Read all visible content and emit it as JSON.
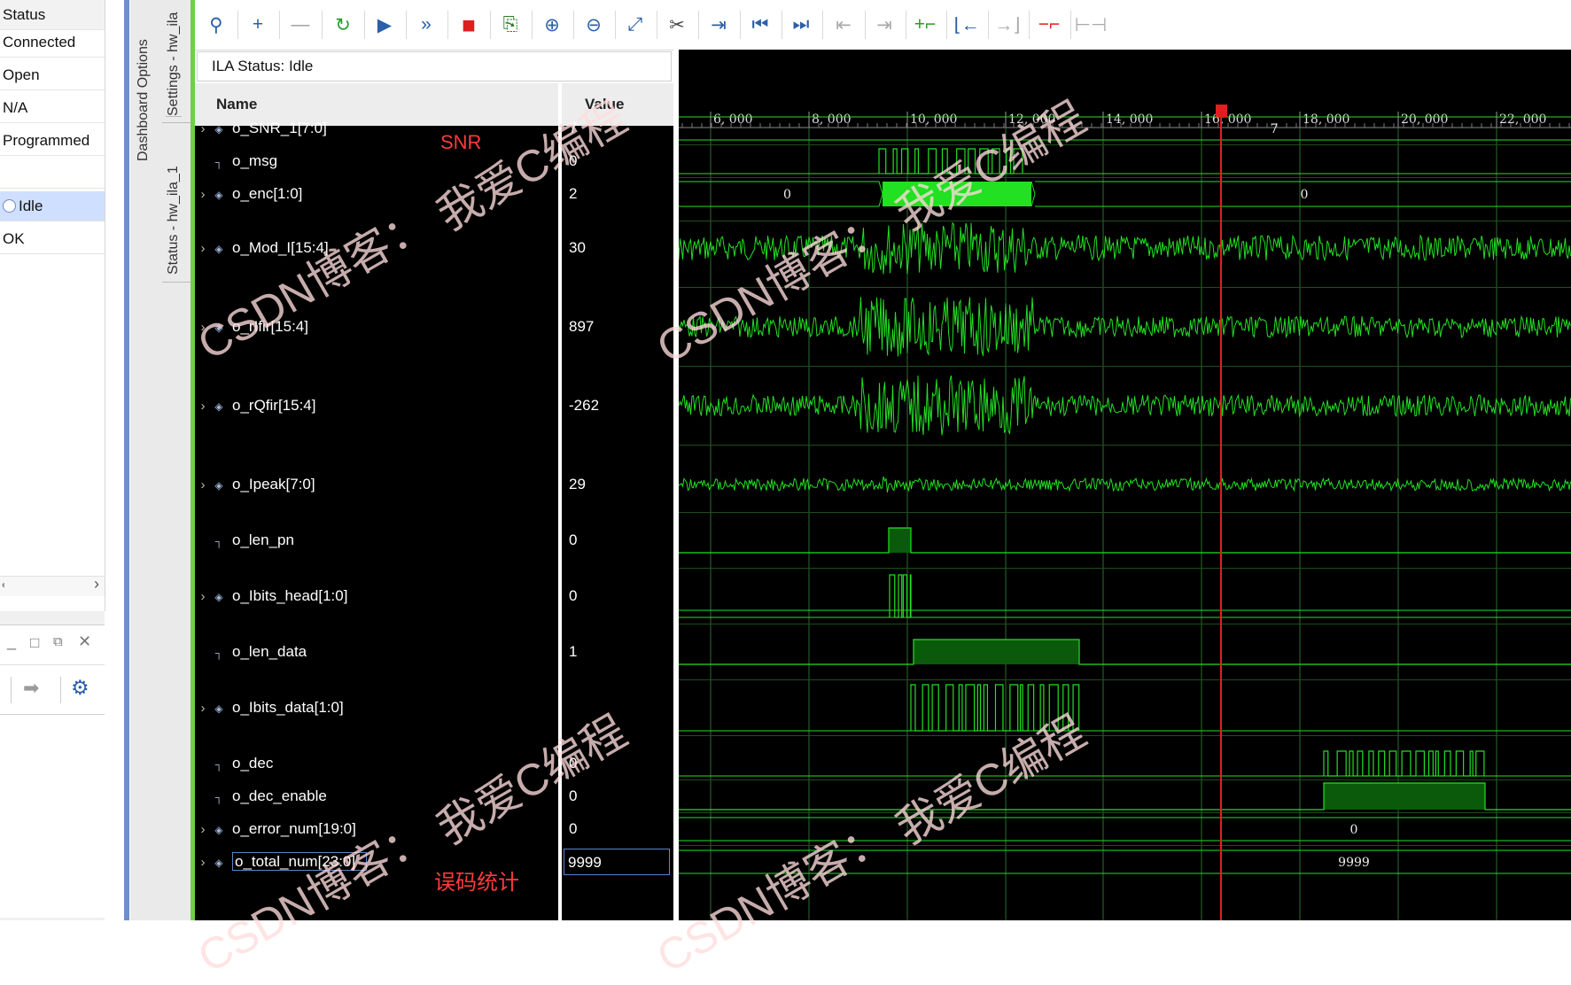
{
  "left_panel": {
    "header": "Status",
    "rows": [
      {
        "text": "Connected",
        "selected": false,
        "radio": false
      },
      {
        "text": "Open",
        "selected": false,
        "radio": false
      },
      {
        "text": "N/A",
        "selected": false,
        "radio": false
      },
      {
        "text": "Programmed",
        "selected": false,
        "radio": false
      },
      {
        "text": "",
        "selected": false,
        "radio": false
      },
      {
        "text": "Idle",
        "selected": true,
        "radio": true
      },
      {
        "text": "OK",
        "selected": false,
        "radio": false
      }
    ]
  },
  "vertical_tabs": {
    "dashboard": "Dashboard Options",
    "settings": "Settings - hw_ila",
    "status": "Status - hw_ila_1"
  },
  "toolbar": {
    "icons": [
      "search-icon",
      "add-icon",
      "remove-icon",
      "refresh-icon",
      "run-icon",
      "run-fast-icon",
      "stop-icon",
      "export-icon",
      "zoom-in-icon",
      "zoom-out-icon",
      "zoom-fit-icon",
      "marker-cut-icon",
      "marker-add-icon",
      "go-first-icon",
      "go-last-icon",
      "prev-edge-icon",
      "next-edge-icon",
      "add-marker-icon",
      "prev-marker-icon",
      "next-marker-icon",
      "delete-marker-icon",
      "measure-icon"
    ]
  },
  "ila_status": "ILA Status:  Idle",
  "columns": {
    "name": "Name",
    "value": "Value"
  },
  "signals": [
    {
      "name": "o_SNR_1[7:0]",
      "value": "7",
      "expandable": true,
      "bus": true
    },
    {
      "name": "o_msg",
      "value": "0",
      "expandable": false,
      "bus": false
    },
    {
      "name": "o_enc[1:0]",
      "value": "2",
      "expandable": true,
      "bus": true
    },
    {
      "name": "o_Mod_I[15:4]",
      "value": "30",
      "expandable": true,
      "bus": true
    },
    {
      "name": "o_rIfir[15:4]",
      "value": "897",
      "expandable": true,
      "bus": true
    },
    {
      "name": "o_rQfir[15:4]",
      "value": "-262",
      "expandable": true,
      "bus": true
    },
    {
      "name": "o_Ipeak[7:0]",
      "value": "29",
      "expandable": true,
      "bus": true
    },
    {
      "name": "o_len_pn",
      "value": "0",
      "expandable": false,
      "bus": false
    },
    {
      "name": "o_Ibits_head[1:0]",
      "value": "0",
      "expandable": true,
      "bus": true
    },
    {
      "name": "o_len_data",
      "value": "1",
      "expandable": false,
      "bus": false
    },
    {
      "name": "o_Ibits_data[1:0]",
      "value": "",
      "expandable": true,
      "bus": true
    },
    {
      "name": "o_dec",
      "value": "0",
      "expandable": false,
      "bus": false
    },
    {
      "name": "o_dec_enable",
      "value": "0",
      "expandable": false,
      "bus": false
    },
    {
      "name": "o_error_num[19:0]",
      "value": "0",
      "expandable": true,
      "bus": true
    },
    {
      "name": "o_total_num[23:0]",
      "value": "9999",
      "expandable": true,
      "bus": true
    }
  ],
  "time_ruler": {
    "labels": [
      "6, 000",
      "8, 000",
      "10, 000",
      "12, 000",
      "14, 000",
      "16, 000",
      "18, 000",
      "20, 000",
      "22, 000"
    ]
  },
  "bus_labels": {
    "snr": "7",
    "enc_left": "0",
    "enc_right": "0",
    "error": "0",
    "total": "9999"
  },
  "annotations": {
    "snr_note": "SNR",
    "error_note": "误码统计"
  },
  "watermark": [
    "我爱C编程",
    "CSDN博客："
  ],
  "colors": {
    "wave": "#22e022",
    "cursor": "#e02020",
    "grid": "#2f6b2f"
  }
}
